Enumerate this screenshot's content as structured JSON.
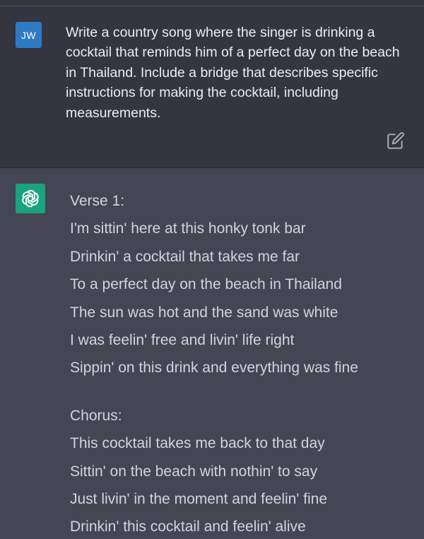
{
  "user_message": {
    "avatar_initials": "JW",
    "text": "Write a country song where the singer is drinking a cocktail that reminds him of a perfect day on the beach in Thailand. Include a bridge that describes specific instructions for making the cocktail, including measurements.",
    "edit_icon": "edit-icon"
  },
  "assistant_message": {
    "avatar_icon": "openai-logo-icon",
    "verse1": {
      "heading": "Verse 1:",
      "lines": [
        "I'm sittin' here at this honky tonk bar",
        "Drinkin' a cocktail that takes me far",
        "To a perfect day on the beach in Thailand",
        "The sun was hot and the sand was white",
        "I was feelin' free and livin' life right",
        "Sippin' on this drink and everything was fine"
      ]
    },
    "chorus": {
      "heading": "Chorus:",
      "lines": [
        "This cocktail takes me back to that day",
        "Sittin' on the beach with nothin' to say",
        "Just livin' in the moment and feelin' fine",
        "Drinkin' this cocktail and feelin' alive"
      ]
    }
  },
  "colors": {
    "user_bg": "#343541",
    "assistant_bg": "#444654",
    "user_avatar": "#2d7bc4",
    "bot_avatar": "#19a37f",
    "text": "#d1d5db"
  }
}
